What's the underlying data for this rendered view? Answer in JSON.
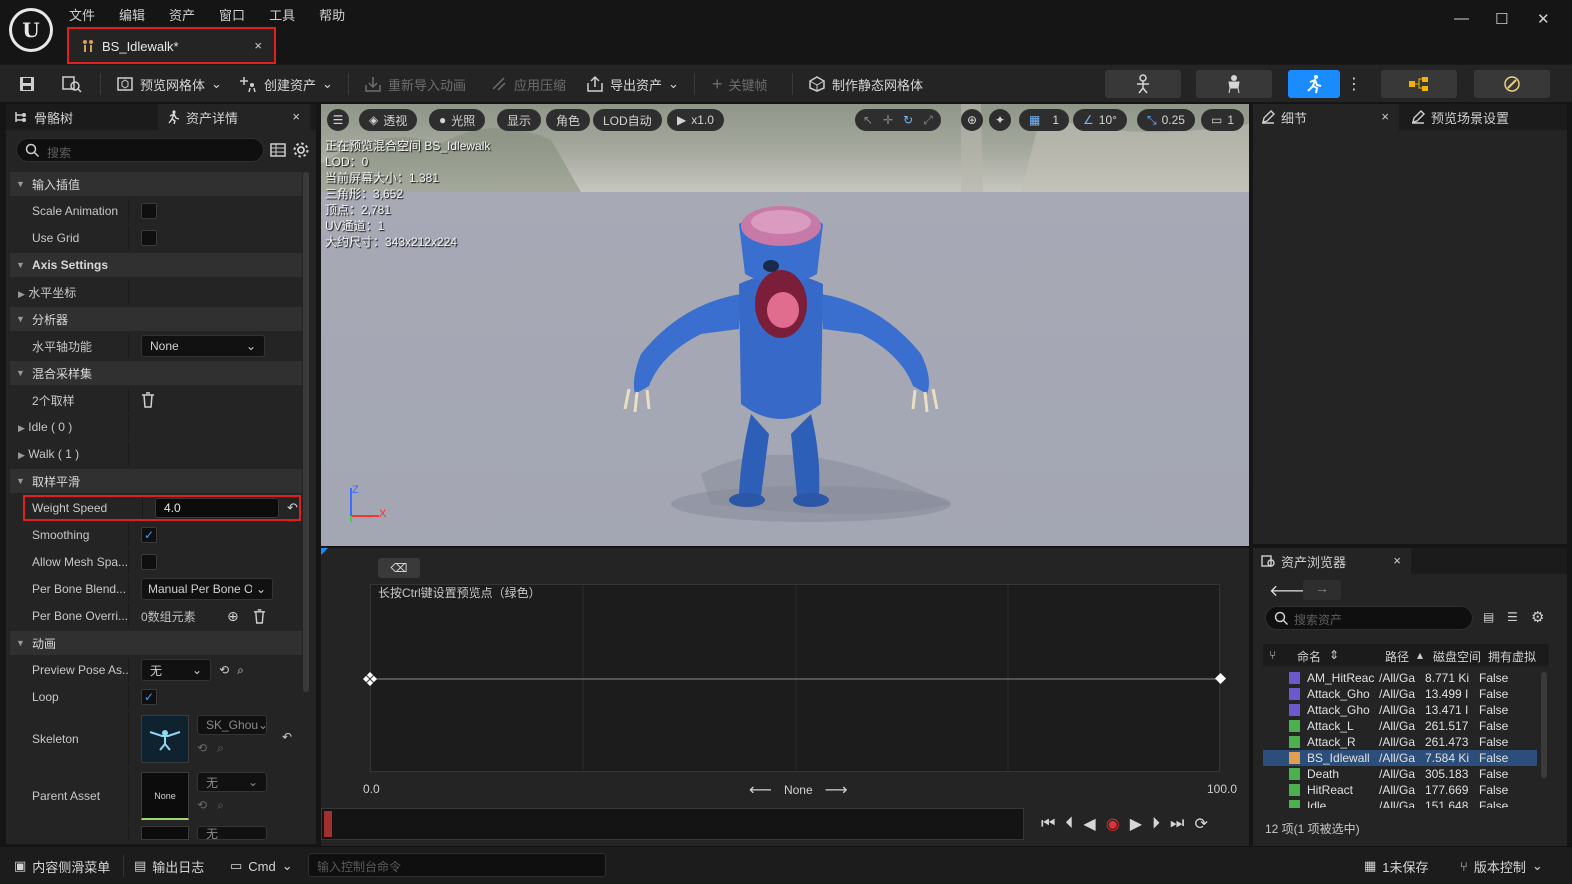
{
  "menu": [
    "文件",
    "编辑",
    "资产",
    "窗口",
    "工具",
    "帮助"
  ],
  "doc_tab": {
    "label": "BS_Idlewalk*",
    "close": "×"
  },
  "window_controls": {
    "minimize": "—",
    "maximize": "☐",
    "close": "✕"
  },
  "toolbar": {
    "preview_mesh": "预览网格体",
    "create_asset": "创建资产",
    "reimport": "重新导入动画",
    "apply_compression": "应用压缩",
    "export_asset": "导出资产",
    "keyframe": "关键帧",
    "make_static_mesh": "制作静态网格体"
  },
  "left_panel": {
    "tab_skeleton": "骨骼树",
    "tab_asset_details": "资产详情",
    "search_placeholder": "搜索",
    "categories": {
      "input_interp": "输入插值",
      "axis_settings": "Axis Settings",
      "analyzer": "分析器",
      "blend_samples": "混合采样集",
      "sample_smoothing": "取样平滑",
      "animation": "动画"
    },
    "props": {
      "scale_animation": "Scale Animation",
      "use_grid": "Use Grid",
      "horizontal_axis": "水平坐标",
      "horizontal_func": "水平轴功能",
      "horizontal_func_value": "None",
      "samples_count": "2个取样",
      "idle": "Idle ( 0 )",
      "walk": "Walk ( 1 )",
      "weight_speed": "Weight Speed",
      "weight_speed_value": "4.0",
      "smoothing": "Smoothing",
      "allow_mesh_space": "Allow Mesh Spa...",
      "per_bone_blend": "Per Bone Blend...",
      "per_bone_blend_value": "Manual Per Bone Ov",
      "per_bone_override": "Per Bone Overri...",
      "per_bone_override_value": "0数组元素",
      "preview_pose": "Preview Pose As...",
      "preview_pose_value": "无",
      "loop": "Loop",
      "skeleton": "Skeleton",
      "skeleton_value": "SK_Ghou",
      "parent_asset": "Parent Asset",
      "parent_asset_value": "无",
      "parent_thumb": "None",
      "trailing_value": "无"
    }
  },
  "viewport": {
    "perspective": "透视",
    "lighting": "光照",
    "show": "显示",
    "character": "角色",
    "lod": "LOD自动",
    "speed": "x1.0",
    "grid_count": "1",
    "angle": "10°",
    "scale": "0.25",
    "cam_speed": "1",
    "stats": [
      "正在预览混合空间 BS_Idlewalk",
      "LOD：0",
      "当前屏幕大小：1.381",
      "三角形：3,652",
      "顶点：2,781",
      "UV通道：1",
      "大约尺寸：343x212x224"
    ],
    "axis_z": "Z",
    "axis_x": "X"
  },
  "blendspace": {
    "hint": "长按Ctrl键设置预览点（绿色）",
    "x_min": "0.0",
    "x_max": "100.0",
    "axis_label": "None"
  },
  "details_panel": {
    "tab_details": "细节",
    "tab_preview_scene": "预览场景设置"
  },
  "content_browser": {
    "title": "资产浏览器",
    "search_placeholder": "搜索资产",
    "columns": [
      "命名",
      "路径",
      "磁盘空间",
      "拥有虚拟"
    ],
    "rows": [
      {
        "name": "AM_HitReac",
        "path": "/All/Ga",
        "size": "8.771 Ki",
        "virtual": "False",
        "kind": "montage"
      },
      {
        "name": "Attack_Gho",
        "path": "/All/Ga",
        "size": "13.499 I",
        "virtual": "False",
        "kind": "montage"
      },
      {
        "name": "Attack_Gho",
        "path": "/All/Ga",
        "size": "13.471 I",
        "virtual": "False",
        "kind": "montage"
      },
      {
        "name": "Attack_L",
        "path": "/All/Ga",
        "size": "261.517",
        "virtual": "False",
        "kind": "sequence"
      },
      {
        "name": "Attack_R",
        "path": "/All/Ga",
        "size": "261.473",
        "virtual": "False",
        "kind": "sequence"
      },
      {
        "name": "BS_Idlewall",
        "path": "/All/Ga",
        "size": "7.584 Ki",
        "virtual": "False",
        "kind": "blendspace",
        "selected": true
      },
      {
        "name": "Death",
        "path": "/All/Ga",
        "size": "305.183",
        "virtual": "False",
        "kind": "sequence"
      },
      {
        "name": "HitReact",
        "path": "/All/Ga",
        "size": "177.669",
        "virtual": "False",
        "kind": "sequence"
      },
      {
        "name": "Idle",
        "path": "/All/Ga",
        "size": "151.648",
        "virtual": "False",
        "kind": "sequence"
      }
    ],
    "footer": "12 项(1 项被选中)"
  },
  "statusbar": {
    "content_drawer": "内容侧滑菜单",
    "output_log": "输出日志",
    "cmd": "Cmd",
    "console_placeholder": "输入控制台命令",
    "unsaved": "1未保存",
    "source_control": "版本控制"
  },
  "colors": {
    "accent": "#1a8cff",
    "highlight_box": "#e02020",
    "selection": "#2b4f7a"
  }
}
